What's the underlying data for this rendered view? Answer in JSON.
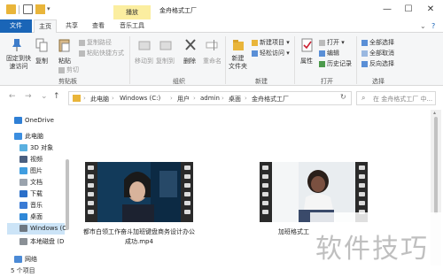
{
  "window": {
    "title": "金舟格式工厂",
    "context_tab": "播放",
    "controls": {
      "minimize": "—",
      "maximize": "☐",
      "close": "✕"
    }
  },
  "ribbon_tabs": [
    "文件",
    "主页",
    "共享",
    "查看",
    "音乐工具"
  ],
  "ribbon_tab_active": "主页",
  "ribbon_right": {
    "chevron": "⌄",
    "help": "?"
  },
  "ribbon": {
    "clipboard": {
      "pin": "固定到快\n速访问",
      "copy": "复制",
      "paste": "粘贴",
      "copy_path": "复制路径",
      "paste_shortcut": "粘贴快捷方式",
      "cut": "剪切",
      "label": "剪贴板"
    },
    "organize": {
      "move_to": "移动到",
      "copy_to": "复制到",
      "delete": "删除",
      "rename": "重命名",
      "label": "组织"
    },
    "new": {
      "new_folder": "新建\n文件夹",
      "new_item": "新建项目 ▾",
      "easy_access": "轻松访问 ▾",
      "label": "新建"
    },
    "open": {
      "properties": "属性",
      "open": "打开 ▾",
      "edit": "编辑",
      "history": "历史记录",
      "label": "打开"
    },
    "select": {
      "select_all": "全部选择",
      "select_none": "全部取消",
      "invert": "反向选择",
      "label": "选择"
    }
  },
  "navigation": {
    "back": "←",
    "forward": "→",
    "recent": "⌄",
    "up": "↑",
    "breadcrumb": [
      "此电脑",
      "Windows (C:)",
      "用户",
      "admin",
      "桌面",
      "金舟格式工厂"
    ],
    "separator": "›",
    "refresh": "↻",
    "search_placeholder": "在 金舟格式工厂 中..."
  },
  "sidebar": {
    "items": [
      {
        "label": "OneDrive",
        "icon": "cloud-icon"
      },
      {
        "label": "此电脑",
        "icon": "computer-icon"
      },
      {
        "label": "3D 对象",
        "icon": "cube-icon"
      },
      {
        "label": "视频",
        "icon": "video-icon"
      },
      {
        "label": "图片",
        "icon": "picture-icon"
      },
      {
        "label": "文档",
        "icon": "document-icon"
      },
      {
        "label": "下载",
        "icon": "download-icon"
      },
      {
        "label": "音乐",
        "icon": "music-icon"
      },
      {
        "label": "桌面",
        "icon": "desktop-icon"
      },
      {
        "label": "Windows (C",
        "icon": "drive-icon"
      },
      {
        "label": "本地磁盘 (D",
        "icon": "drive-icon"
      },
      {
        "label": "网络",
        "icon": "network-icon"
      }
    ]
  },
  "files": [
    {
      "name": "都市白领工作奋斗加班键盘商务设计办公成功.mp4",
      "type": "video"
    },
    {
      "name": "加班格式工",
      "type": "video"
    }
  ],
  "status": {
    "item_count": "5 个项目"
  },
  "watermark": "软件技巧",
  "colors": {
    "accent": "#1a65b7",
    "selected": "#cce4f7",
    "context_tab": "#fbeea0"
  }
}
